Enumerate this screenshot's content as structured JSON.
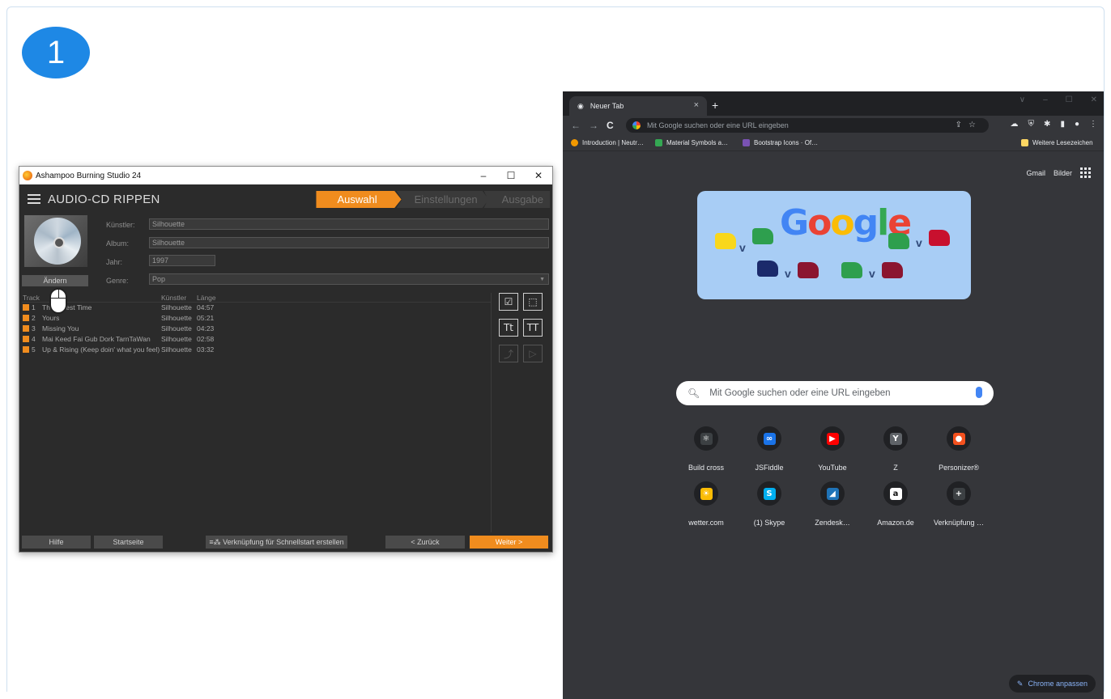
{
  "step_number": "1",
  "ashampoo": {
    "window_title": "Ashampoo Burning Studio 24",
    "window_controls": [
      "–",
      "☐",
      "✕"
    ],
    "page_title": "AUDIO-CD RIPPEN",
    "steps": [
      "Auswahl",
      "Einstellungen",
      "Ausgabe"
    ],
    "fields": {
      "artist_label": "Künstler:",
      "artist_value": "Silhouette",
      "album_label": "Album:",
      "album_value": "Silhouette",
      "year_label": "Jahr:",
      "year_value": "1997",
      "genre_label": "Genre:",
      "genre_value": "Pop"
    },
    "change_button": "Ändern",
    "list_headers": {
      "track": "Track",
      "artist": "Künstler",
      "length": "Länge"
    },
    "tracks": [
      {
        "no": "1",
        "title": "Th… …est Time",
        "artist": "Silhouette",
        "length": "04:57"
      },
      {
        "no": "2",
        "title": "Yours",
        "artist": "Silhouette",
        "length": "05:21"
      },
      {
        "no": "3",
        "title": "Missing You",
        "artist": "Silhouette",
        "length": "04:23"
      },
      {
        "no": "4",
        "title": "Mai Keed Fai Gub Dork TarnTaWan",
        "artist": "Silhouette",
        "length": "02:58"
      },
      {
        "no": "5",
        "title": "Up & Rising (Keep doin' what you feel)",
        "artist": "Silhouette",
        "length": "03:32"
      }
    ],
    "tools": [
      "☑",
      "⬚",
      "Tt",
      "TT",
      "⤴",
      "▷"
    ],
    "footer": {
      "help": "Hilfe",
      "start": "Startseite",
      "shortcut": "Verknüpfung für Schnellstart erstellen",
      "back": "< Zurück",
      "next": "Weiter >"
    },
    "accent_color": "#f08c1e"
  },
  "chrome": {
    "tab_title": "Neuer Tab",
    "tab_close": "×",
    "new_tab": "+",
    "nav": [
      "←",
      "→",
      "C"
    ],
    "omnibox_placeholder": "Mit Google suchen oder eine URL eingeben",
    "omnibox_right": "⇪☆",
    "extension_icons": [
      "puzzle-icon",
      "sidebar-icon",
      "profile-icon",
      "menu-icon"
    ],
    "bookmarks": [
      "Introduction | Neutr…",
      "Material Symbols a…",
      "Bootstrap Icons · Of…"
    ],
    "bookmarks_folder": "Weitere Lesezeichen",
    "top_links": [
      "Gmail",
      "Bilder"
    ],
    "doodle_word": "Google",
    "search_placeholder": "Mit Google suchen oder eine URL eingeben",
    "shortcuts": [
      {
        "label": "Build cross",
        "icon": "build-cross-icon",
        "color": "#3c4043"
      },
      {
        "label": "JSFiddle",
        "icon": "jsfiddle-icon",
        "color": "#1a73e8"
      },
      {
        "label": "YouTube",
        "icon": "youtube-icon",
        "color": "#ff0000"
      },
      {
        "label": "Z",
        "icon": "yandex-icon",
        "color": "#5f6368"
      },
      {
        "label": "Personizer®",
        "icon": "personizer-icon",
        "color": "#f4511e"
      },
      {
        "label": "wetter.com",
        "icon": "wetter-icon",
        "color": "#fbbc05"
      },
      {
        "label": "(1) Skype",
        "icon": "skype-icon",
        "color": "#00aff0"
      },
      {
        "label": "Zendesk…",
        "icon": "zendesk-icon",
        "color": "#1f73b7"
      },
      {
        "label": "Amazon.de",
        "icon": "amazon-icon",
        "color": "#ffffff"
      },
      {
        "label": "Verknüpfung …",
        "icon": "add-shortcut-icon",
        "color": "#3c4043"
      }
    ],
    "customize_button": "Chrome anpassen"
  }
}
